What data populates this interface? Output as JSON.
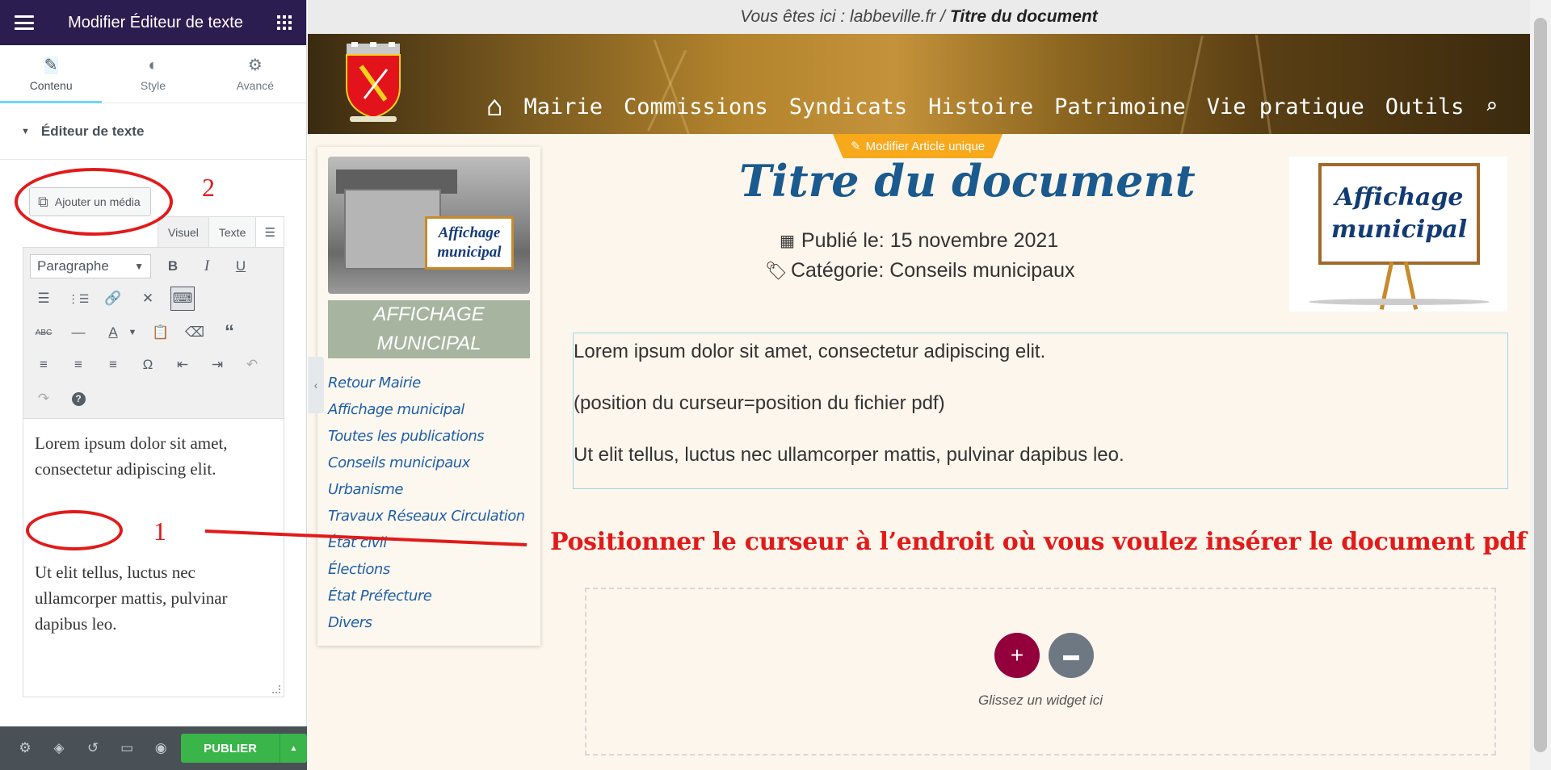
{
  "panel": {
    "header_title": "Modifier Éditeur de texte",
    "tabs": [
      {
        "label": "Contenu",
        "icon": "pencil-icon"
      },
      {
        "label": "Style",
        "icon": "half-circle-icon"
      },
      {
        "label": "Avancé",
        "icon": "gear-icon"
      }
    ],
    "section_title": "Éditeur de texte",
    "media_button": "Ajouter un média",
    "mode_tabs": {
      "visual": "Visuel",
      "text": "Texte"
    },
    "format_select": "Paragraphe",
    "editor": {
      "para1": "Lorem ipsum dolor sit amet, consectetur adipiscing elit.",
      "para2": "Ut elit tellus, luctus nec ullamcorper mattis, pulvinar dapibus leo."
    },
    "publish_button": "PUBLIER"
  },
  "annotations": {
    "num1": "1",
    "num2": "2",
    "instruction": "Positionner le curseur à l’endroit où vous voulez insérer le document pdf",
    "color": "#e21a1a"
  },
  "preview": {
    "breadcrumb_prefix": "Vous êtes ici : labbeville.fr /",
    "breadcrumb_current": "Titre du document",
    "nav": [
      "Mairie",
      "Commissions",
      "Syndicats",
      "Histoire",
      "Patrimoine",
      "Vie pratique",
      "Outils"
    ],
    "edit_tab": "Modifier Article unique",
    "sidebar": {
      "photo_sign_line1": "Affichage",
      "photo_sign_line2": "municipal",
      "banner_line1": "AFFICHAGE",
      "banner_line2": "MUNICIPAL",
      "links": [
        "Retour Mairie",
        "Affichage municipal",
        "Toutes les publications",
        "Conseils municipaux",
        "Urbanisme",
        "Travaux Réseaux Circulation",
        "État civil",
        "Élections",
        "État Préfecture",
        "Divers"
      ]
    },
    "doc_title": "Titre du document",
    "published": "Publié le: 15 novembre 2021",
    "category": "Catégorie: Conseils municipaux",
    "affiche_line1": "Affichage",
    "affiche_line2": "municipal",
    "content": {
      "p1": "Lorem ipsum dolor sit amet, consectetur adipiscing elit.",
      "p2": "(position du curseur=position du fichier pdf)",
      "p3": "Ut elit tellus, luctus nec ullamcorper mattis, pulvinar dapibus leo."
    },
    "drop_label": "Glissez un widget ici"
  },
  "colors": {
    "panel_header": "#2b1d4f",
    "publish": "#39b54a",
    "title_blue": "#1a5a8e",
    "add_widget": "#93003c",
    "edit_tab": "#f7a81b"
  }
}
